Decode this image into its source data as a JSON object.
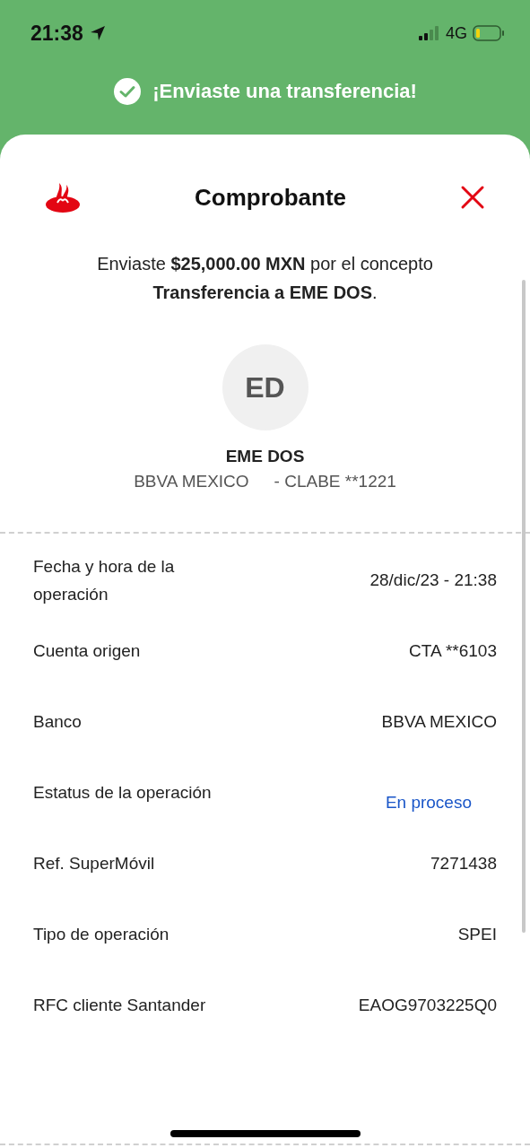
{
  "status_bar": {
    "time": "21:38",
    "network": "4G"
  },
  "banner": {
    "message": "¡Enviaste una transferencia!"
  },
  "header": {
    "title": "Comprobante"
  },
  "summary": "Enviaste  **$25,000.00 MXN** por el concepto **Transferencia a EME DOS**.",
  "recipient": {
    "initials": "ED",
    "name": "EME DOS",
    "bank": "BBVA MEXICO",
    "account": "- CLABE **1221"
  },
  "details": [
    {
      "label": "Fecha y hora de la operación",
      "value": "28/dic/23 - 21:38",
      "kind": "plain"
    },
    {
      "label": "Cuenta origen",
      "value": "CTA **6103",
      "kind": "plain"
    },
    {
      "label": "Banco",
      "value": "BBVA MEXICO",
      "kind": "plain"
    },
    {
      "label": "Estatus de la operación",
      "value": "En proceso",
      "kind": "status"
    },
    {
      "label": "Ref. SuperMóvil",
      "value": "7271438",
      "kind": "plain"
    },
    {
      "label": "Tipo de operación",
      "value": "SPEI",
      "kind": "plain"
    },
    {
      "label": "RFC cliente Santander",
      "value": "EAOG9703225Q0",
      "kind": "plain"
    }
  ]
}
